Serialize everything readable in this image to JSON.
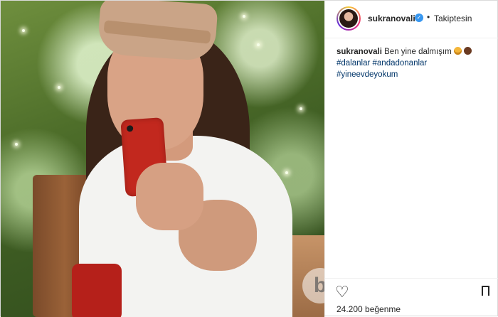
{
  "post": {
    "username": "sukranovali",
    "verified_icon": "verified-badge-icon",
    "separator": "•",
    "follow_status": "Takiptesin",
    "caption": {
      "username": "sukranovali",
      "text": "Ben yine dalmışım",
      "emoji": [
        "grinning-face-emoji",
        "see-no-evil-monkey-emoji"
      ],
      "hashtags": "#dalanlar #andadonanlar #yineevdeyokum"
    },
    "likes": "24.200 beğenme",
    "watermark": "b"
  },
  "colors": {
    "verified": "#3897f0",
    "hashtag": "#003569",
    "text": "#262626",
    "border": "#dbdbdb"
  }
}
